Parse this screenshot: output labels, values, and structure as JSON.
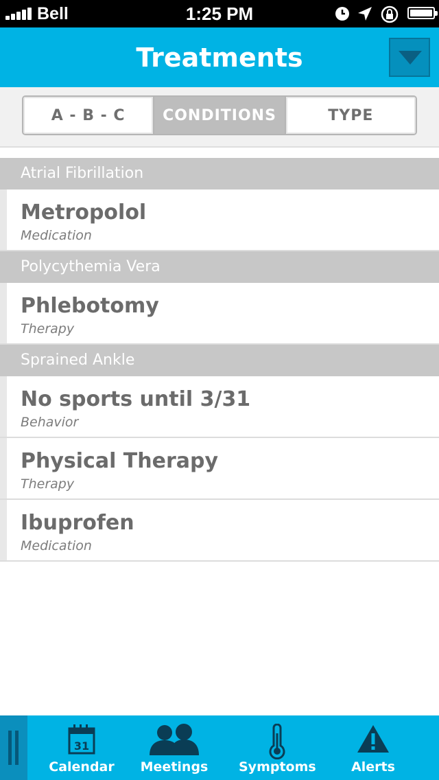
{
  "status_bar": {
    "carrier": "Bell",
    "time": "1:25 PM"
  },
  "nav": {
    "title": "Treatments",
    "menu_icon": "triangle-down-icon"
  },
  "segments": [
    {
      "label": "A - B - C",
      "active": false
    },
    {
      "label": "CONDITIONS",
      "active": true
    },
    {
      "label": "TYPE",
      "active": false
    }
  ],
  "sections": [
    {
      "header": "Atrial Fibrillation",
      "items": [
        {
          "title": "Metropolol",
          "type": "Medication"
        }
      ]
    },
    {
      "header": "Polycythemia Vera",
      "items": [
        {
          "title": "Phlebotomy",
          "type": "Therapy"
        }
      ]
    },
    {
      "header": "Sprained Ankle",
      "items": [
        {
          "title": "No sports until 3/31",
          "type": "Behavior"
        },
        {
          "title": "Physical Therapy",
          "type": "Therapy"
        },
        {
          "title": "Ibuprofen",
          "type": "Medication"
        }
      ]
    }
  ],
  "tab_bar": {
    "calendar_day": "31",
    "tabs": [
      {
        "label": "Calendar",
        "icon": "calendar-icon"
      },
      {
        "label": "Meetings",
        "icon": "people-icon"
      },
      {
        "label": "Symptoms",
        "icon": "thermometer-icon"
      },
      {
        "label": "Alerts",
        "icon": "warning-icon"
      }
    ]
  },
  "colors": {
    "accent": "#00b3e4",
    "section_header": "#c7c7c7",
    "dropdown_button": "#0590bd"
  }
}
